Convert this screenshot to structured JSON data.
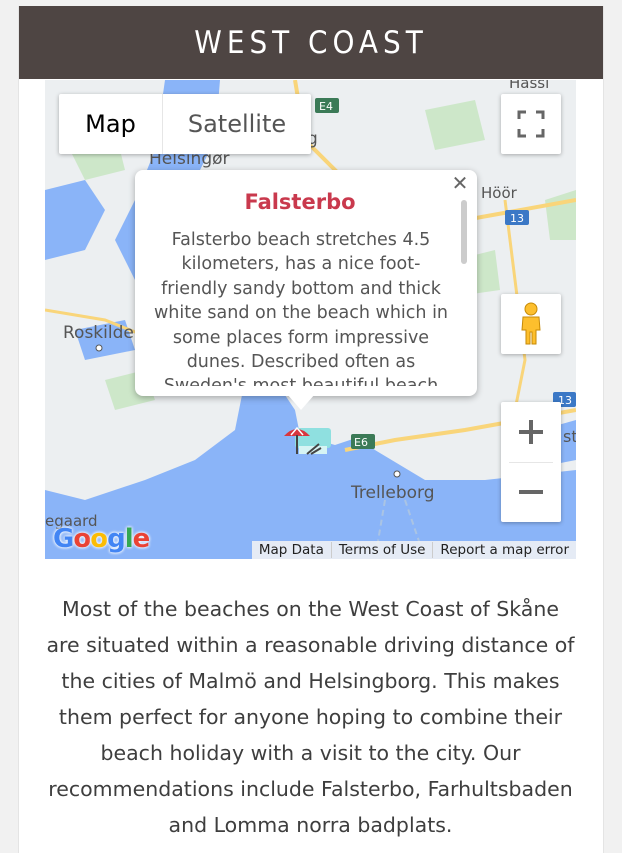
{
  "header": {
    "title": "WEST COAST"
  },
  "map": {
    "type_controls": {
      "map_label": "Map",
      "satellite_label": "Satellite"
    },
    "place_labels": {
      "helsingor": "Helsingør",
      "hoor": "Höör",
      "roskilde": "Roskilde",
      "trelleborg": "Trelleborg",
      "hassleholm_partial": "Hässl",
      "g_partial": "g",
      "st_partial": "st",
      "egaard_partial": "egaard"
    },
    "road_labels": {
      "e4": "E4",
      "r13a": "13",
      "r13b": "13",
      "e6": "E6"
    },
    "info_window": {
      "title": "Falsterbo",
      "body": "Falsterbo beach stretches 4.5 kilometers, has a nice foot-friendly sandy bottom and thick white sand on the beach which in some places form impressive dunes. Described often as Sweden's most beautiful beach and rated"
    },
    "attribution": {
      "map_data": "Map Data",
      "terms": "Terms of Use",
      "report": "Report a map error"
    },
    "logo": "Google",
    "colors": {
      "water": "#8ab4f8",
      "land": "#e8eaed",
      "park": "#c8e6c9",
      "highway": "#f9d57a",
      "title_accent": "#c9394d"
    }
  },
  "content": {
    "paragraph": "Most of the beaches on the West Coast of Skåne are situated within a reasonable driving distance of the cities of Malmö and Helsingborg. This makes them perfect for anyone hoping to combine their beach holiday with a visit to the city. Our recommendations include Falsterbo, Farhultsbaden and Lomma norra badplats."
  }
}
